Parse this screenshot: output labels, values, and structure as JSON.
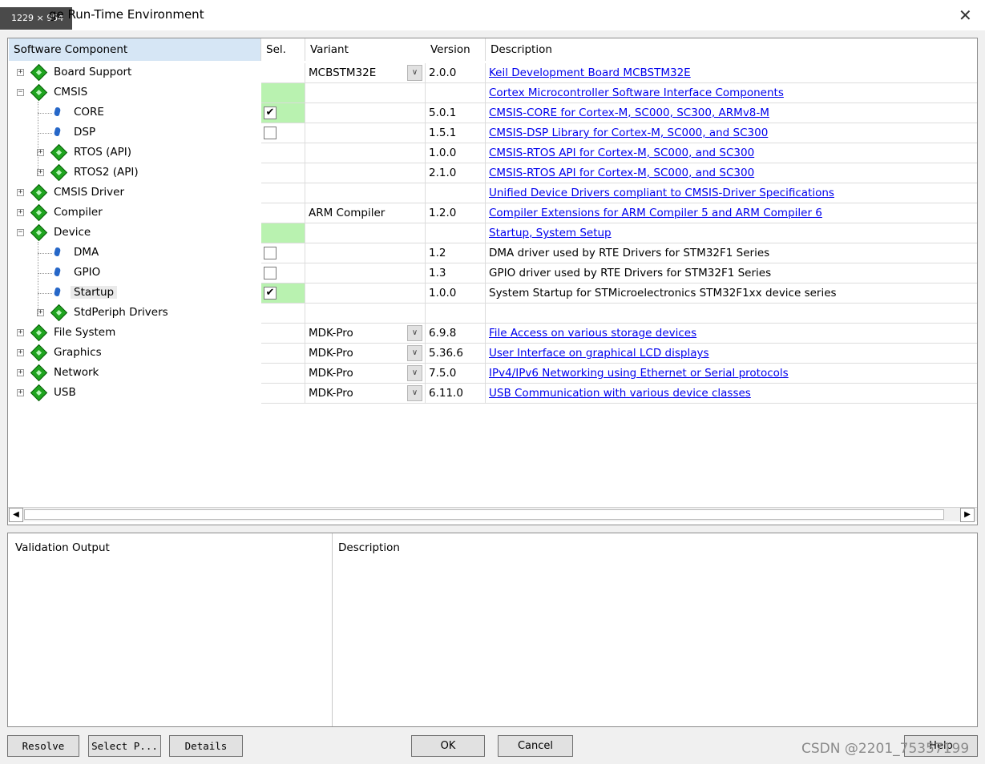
{
  "window": {
    "title": "ge Run-Time Environment",
    "size_badge": "1229 × 954",
    "close_glyph": "✕"
  },
  "grid": {
    "columns": {
      "component": "Software Component",
      "sel": "Sel.",
      "variant": "Variant",
      "version": "Version",
      "description": "Description"
    },
    "rows": [
      {
        "label": "Board Support",
        "level": 0,
        "expander": "+",
        "icon": "component-gem-icon",
        "sel": "",
        "variant": "MCBSTM32E",
        "dropdown": true,
        "version": "2.0.0",
        "description": "Keil Development Board MCBSTM32E",
        "link": true,
        "green": false
      },
      {
        "label": "CMSIS",
        "level": 0,
        "expander": "−",
        "icon": "component-gem-icon",
        "sel": "",
        "variant": "",
        "dropdown": false,
        "version": "",
        "description": "Cortex Microcontroller Software Interface Components",
        "link": true,
        "green": true
      },
      {
        "label": "CORE",
        "level": 1,
        "expander": "",
        "icon": "component-leaf-icon",
        "sel": "checked",
        "variant": "",
        "dropdown": false,
        "version": "5.0.1",
        "description": "CMSIS-CORE for Cortex-M, SC000, SC300, ARMv8-M",
        "link": true,
        "green": true
      },
      {
        "label": "DSP",
        "level": 1,
        "expander": "",
        "icon": "component-leaf-icon",
        "sel": "unchecked",
        "variant": "",
        "dropdown": false,
        "version": "1.5.1",
        "description": "CMSIS-DSP Library for Cortex-M, SC000, and SC300",
        "link": true,
        "green": false
      },
      {
        "label": "RTOS (API)",
        "level": 1,
        "expander": "+",
        "icon": "component-gem-icon",
        "sel": "",
        "variant": "",
        "dropdown": false,
        "version": "1.0.0",
        "description": "CMSIS-RTOS API for Cortex-M, SC000, and SC300",
        "link": true,
        "green": false
      },
      {
        "label": "RTOS2 (API)",
        "level": 1,
        "expander": "+",
        "icon": "component-gem-icon",
        "sel": "",
        "variant": "",
        "dropdown": false,
        "version": "2.1.0",
        "description": "CMSIS-RTOS API for Cortex-M, SC000, and SC300",
        "link": true,
        "green": false
      },
      {
        "label": "CMSIS Driver",
        "level": 0,
        "expander": "+",
        "icon": "component-gem-icon",
        "sel": "",
        "variant": "",
        "dropdown": false,
        "version": "",
        "description": "Unified Device Drivers compliant to CMSIS-Driver Specifications",
        "link": true,
        "green": false
      },
      {
        "label": "Compiler",
        "level": 0,
        "expander": "+",
        "icon": "component-gem-icon",
        "sel": "",
        "variant": "ARM Compiler",
        "dropdown": false,
        "version": "1.2.0",
        "description": "Compiler Extensions for ARM Compiler 5 and ARM Compiler 6",
        "link": true,
        "green": false
      },
      {
        "label": "Device",
        "level": 0,
        "expander": "−",
        "icon": "component-gem-icon",
        "sel": "",
        "variant": "",
        "dropdown": false,
        "version": "",
        "description": "Startup, System Setup",
        "link": true,
        "green": true
      },
      {
        "label": "DMA",
        "level": 1,
        "expander": "",
        "icon": "component-leaf-icon",
        "sel": "unchecked",
        "variant": "",
        "dropdown": false,
        "version": "1.2",
        "description": "DMA driver used by RTE Drivers for STM32F1 Series",
        "link": false,
        "green": false
      },
      {
        "label": "GPIO",
        "level": 1,
        "expander": "",
        "icon": "component-leaf-icon",
        "sel": "unchecked",
        "variant": "",
        "dropdown": false,
        "version": "1.3",
        "description": "GPIO driver used by RTE Drivers for STM32F1 Series",
        "link": false,
        "green": false
      },
      {
        "label": "Startup",
        "level": 1,
        "expander": "",
        "icon": "component-leaf-icon",
        "sel": "checked",
        "variant": "",
        "dropdown": false,
        "version": "1.0.0",
        "description": "System Startup for STMicroelectronics STM32F1xx device series",
        "link": false,
        "green": true,
        "selected": true
      },
      {
        "label": "StdPeriph Drivers",
        "level": 1,
        "expander": "+",
        "icon": "component-gem-icon",
        "sel": "",
        "variant": "",
        "dropdown": false,
        "version": "",
        "description": "",
        "link": false,
        "green": false
      },
      {
        "label": "File System",
        "level": 0,
        "expander": "+",
        "icon": "component-gem-icon",
        "sel": "",
        "variant": "MDK-Pro",
        "dropdown": true,
        "version": "6.9.8",
        "description": "File Access on various storage devices",
        "link": true,
        "green": false
      },
      {
        "label": "Graphics",
        "level": 0,
        "expander": "+",
        "icon": "component-gem-icon",
        "sel": "",
        "variant": "MDK-Pro",
        "dropdown": true,
        "version": "5.36.6",
        "description": "User Interface on graphical LCD displays",
        "link": true,
        "green": false
      },
      {
        "label": "Network",
        "level": 0,
        "expander": "+",
        "icon": "component-gem-icon",
        "sel": "",
        "variant": "MDK-Pro",
        "dropdown": true,
        "version": "7.5.0",
        "description": "IPv4/IPv6 Networking using Ethernet or Serial protocols",
        "link": true,
        "green": false
      },
      {
        "label": "USB",
        "level": 0,
        "expander": "+",
        "icon": "component-gem-icon",
        "sel": "",
        "variant": "MDK-Pro",
        "dropdown": true,
        "version": "6.11.0",
        "description": "USB Communication with various device classes",
        "link": true,
        "green": false
      }
    ]
  },
  "scrollbar": {
    "left_arrow": "◀",
    "right_arrow": "▶"
  },
  "validation": {
    "output_header": "Validation Output",
    "description_header": "Description"
  },
  "buttons": {
    "resolve": "Resolve",
    "select_packs": "Select P...",
    "details": "Details",
    "ok": "OK",
    "cancel": "Cancel",
    "help": "Help"
  },
  "watermark": "CSDN @2201_75357199",
  "colors": {
    "selected_green": "#b9f2b0",
    "link": "#0000ee",
    "header_highlight": "#d6e6f5"
  }
}
